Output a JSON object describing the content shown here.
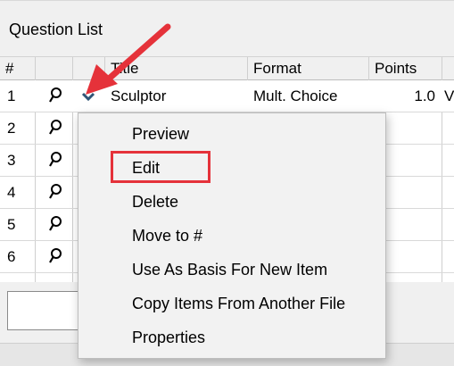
{
  "panel": {
    "title": "Question List"
  },
  "grid": {
    "columns": [
      "#",
      "",
      "",
      "Title",
      "Format",
      "Points",
      ""
    ],
    "rows": [
      {
        "num": "1",
        "title": "Sculptor",
        "format": "Mult. Choice",
        "points": "1.0",
        "extra": "V"
      },
      {
        "num": "2",
        "title": "",
        "format": "",
        "points": "",
        "extra": ""
      },
      {
        "num": "3",
        "title": "",
        "format": "",
        "points": "",
        "extra": ""
      },
      {
        "num": "4",
        "title": "",
        "format": "",
        "points": "",
        "extra": ""
      },
      {
        "num": "5",
        "title": "",
        "format": "",
        "points": "",
        "extra": ""
      },
      {
        "num": "6",
        "title": "",
        "format": "",
        "points": "",
        "extra": ""
      }
    ]
  },
  "context_menu": {
    "items": [
      "Preview",
      "Edit",
      "Delete",
      "Move to #",
      "Use As Basis For New Item",
      "Copy Items From Another File",
      "Properties"
    ]
  },
  "icons": {
    "row_search": "magnifier-icon",
    "row_dropdown": "chevron-down-icon",
    "annotation": "red-arrow-icon"
  },
  "colors": {
    "annotation": "#e5323a",
    "chevron": "#2f5576"
  }
}
